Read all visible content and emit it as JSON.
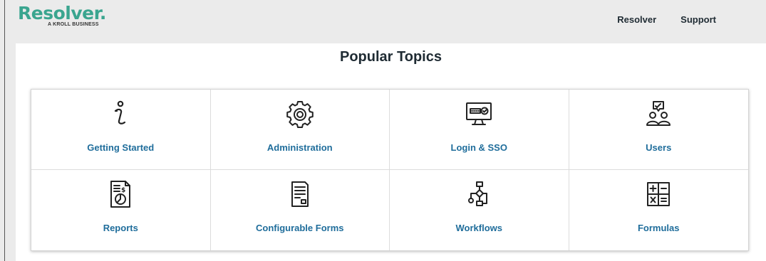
{
  "header": {
    "logo_text": "Resolver.",
    "logo_tagline": "A KROLL BUSINESS",
    "nav": [
      "Resolver",
      "Support"
    ]
  },
  "main": {
    "title": "Popular Topics",
    "topics": [
      {
        "label": "Getting Started",
        "icon": "info-icon"
      },
      {
        "label": "Administration",
        "icon": "gear-icon"
      },
      {
        "label": "Login & SSO",
        "icon": "monitor-login-icon"
      },
      {
        "label": "Users",
        "icon": "users-icon"
      },
      {
        "label": "Reports",
        "icon": "report-icon"
      },
      {
        "label": "Configurable Forms",
        "icon": "form-icon"
      },
      {
        "label": "Workflows",
        "icon": "workflow-icon"
      },
      {
        "label": "Formulas",
        "icon": "calculator-icon"
      }
    ]
  },
  "colors": {
    "brand": "#3aa58f",
    "link": "#1f6d9b",
    "text": "#1f2b33"
  }
}
